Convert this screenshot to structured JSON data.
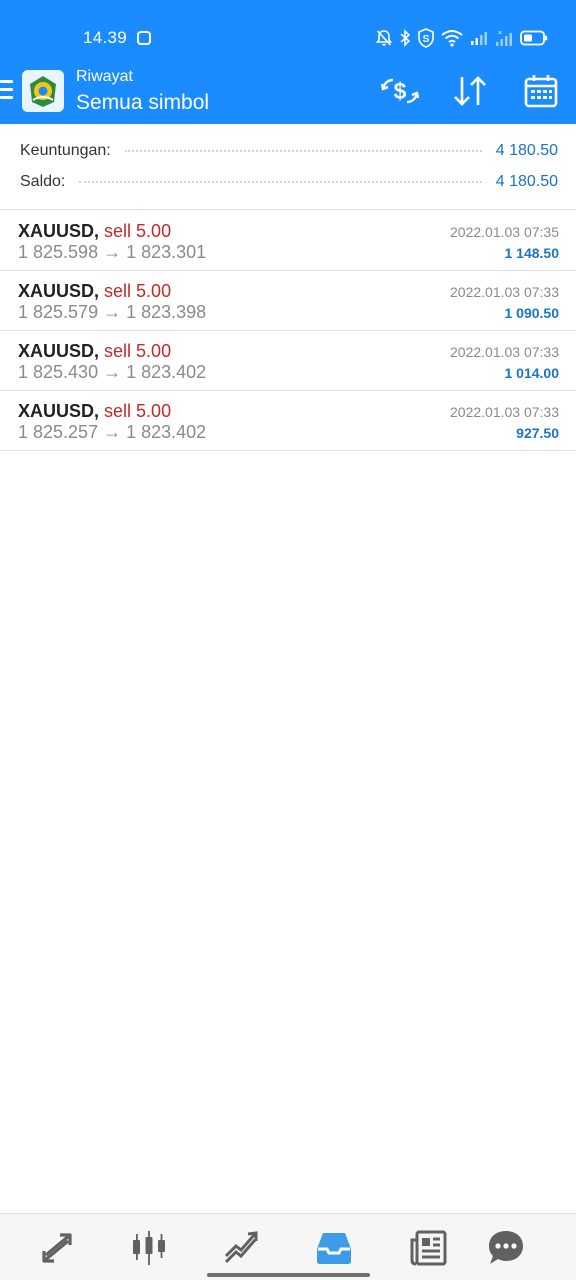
{
  "status_bar": {
    "time": "14.39",
    "icons": [
      "notification-icon",
      "mute-icon",
      "bluetooth-icon",
      "vpn-shield-icon",
      "wifi-icon",
      "signal-icon",
      "signal-icon-2",
      "battery-icon"
    ]
  },
  "header": {
    "subtitle": "Riwayat",
    "title": "Semua simbol",
    "actions": [
      "currency-exchange-icon",
      "sort-icon",
      "calendar-icon"
    ]
  },
  "summary": {
    "profit_label": "Keuntungan:",
    "profit_value": "4 180.50",
    "balance_label": "Saldo:",
    "balance_value": "4 180.50"
  },
  "deals": [
    {
      "symbol": "XAUUSD,",
      "side": "sell 5.00",
      "prices": "1 825.598 → 1 823.301",
      "datetime": "2022.01.03 07:35",
      "profit": "1 148.50"
    },
    {
      "symbol": "XAUUSD,",
      "side": "sell 5.00",
      "prices": "1 825.579 → 1 823.398",
      "datetime": "2022.01.03 07:33",
      "profit": "1 090.50"
    },
    {
      "symbol": "XAUUSD,",
      "side": "sell 5.00",
      "prices": "1 825.430 → 1 823.402",
      "datetime": "2022.01.03 07:33",
      "profit": "1 014.00"
    },
    {
      "symbol": "XAUUSD,",
      "side": "sell 5.00",
      "prices": "1 825.257 → 1 823.402",
      "datetime": "2022.01.03 07:33",
      "profit": "927.50"
    }
  ],
  "bottom_nav": {
    "items": [
      "quotes-icon",
      "chart-icon",
      "trade-icon",
      "history-icon",
      "news-icon",
      "chat-icon"
    ],
    "active": "history-icon"
  },
  "colors": {
    "header_bg": "#1a8cff",
    "value_blue": "#1a73c9",
    "sell_red": "#c62828",
    "active_nav": "#3d9be9",
    "inactive_nav": "#616161"
  }
}
